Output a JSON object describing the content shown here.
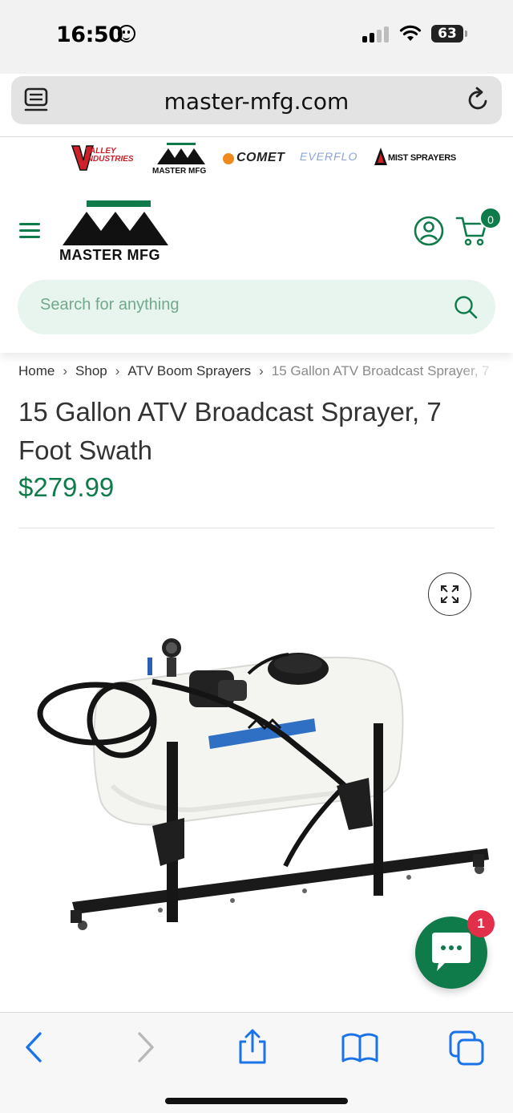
{
  "status_bar": {
    "time": "16:50",
    "battery": "63"
  },
  "browser": {
    "url": "master-mfg.com"
  },
  "brands": {
    "items": [
      "VALLEY INDUSTRIES",
      "MASTER MFG",
      "COMET",
      "EVERFLO",
      "MIST SPRAYERS"
    ]
  },
  "header": {
    "logo_text": "MASTER MFG",
    "cart_count": "0",
    "search_placeholder": "Search for anything"
  },
  "breadcrumb": {
    "items": [
      "Home",
      "Shop",
      "ATV Boom Sprayers",
      "15 Gallon ATV Broadcast Sprayer, 7"
    ]
  },
  "product": {
    "title": "15 Gallon ATV Broadcast Sprayer, 7 Foot Swath",
    "price": "$279.99"
  },
  "chat": {
    "badge": "1"
  },
  "colors": {
    "brand_green": "#0f7a4a",
    "search_bg": "#e8f4ee",
    "badge_red": "#e3304a"
  },
  "icons": [
    "tabs-icon",
    "reload-icon",
    "menu-icon",
    "account-icon",
    "cart-icon",
    "search-icon",
    "expand-icon",
    "chat-icon",
    "back-icon",
    "forward-icon",
    "share-icon",
    "bookmarks-icon",
    "tabs-overview-icon"
  ]
}
